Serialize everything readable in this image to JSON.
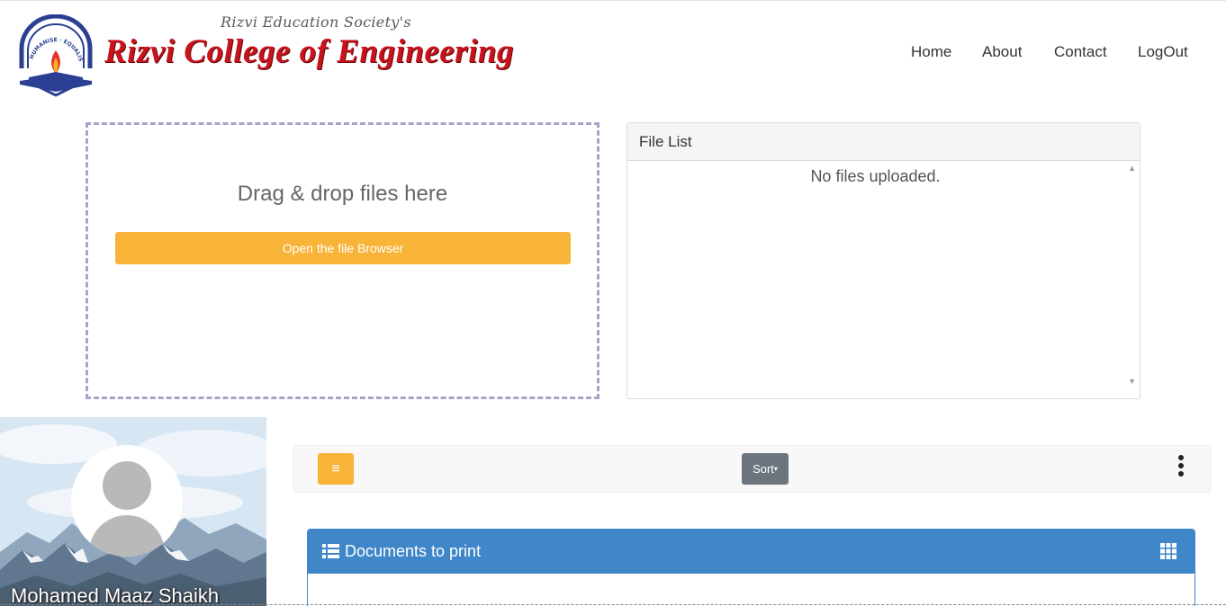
{
  "header": {
    "society": "Rizvi Education Society's",
    "college": "Rizvi College of Engineering",
    "emblem_text": [
      "HUMANISE",
      "EQUALISE",
      "SPIRITUALISE"
    ],
    "nav": [
      "Home",
      "About",
      "Contact",
      "LogOut"
    ]
  },
  "dropzone": {
    "title": "Drag & drop files here",
    "button_label": "Open the file Browser"
  },
  "file_list": {
    "title": "File List",
    "empty_message": "No files uploaded."
  },
  "profile": {
    "name": "Mohamed Maaz Shaikh"
  },
  "toolbar": {
    "menu_icon": "hamburger-icon",
    "sort_label": "Sort",
    "more_icon": "vertical-dots-icon"
  },
  "documents": {
    "title": "Documents to print",
    "header_icon": "list-icon",
    "view_icon": "grid-icon"
  },
  "colors": {
    "brand_red": "#c8121c",
    "accent_orange": "#f7b438",
    "panel_blue": "#3f87c9",
    "sort_grey": "#6c757d"
  }
}
